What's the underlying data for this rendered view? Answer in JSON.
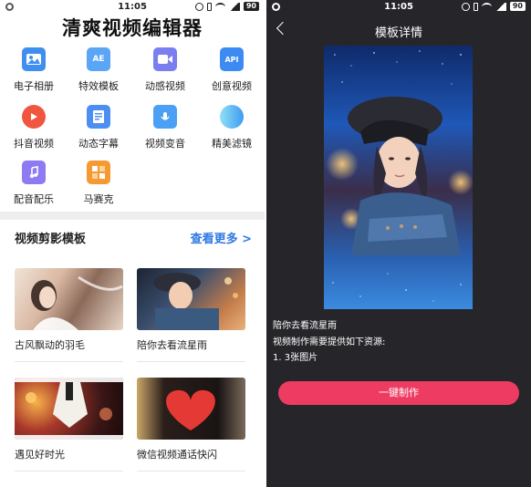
{
  "status": {
    "time": "11:05",
    "battery": "90"
  },
  "left": {
    "app_title": "清爽视频编辑器",
    "features": [
      {
        "label": "电子相册",
        "icon": "photo-album-icon",
        "color": "#3f8ef0"
      },
      {
        "label": "特效模板",
        "icon": "ae-template-icon",
        "color": "#5aa5f5",
        "glyph": "AE"
      },
      {
        "label": "动感视频",
        "icon": "dynamic-video-icon",
        "color": "#7a7ef0"
      },
      {
        "label": "创意视频",
        "icon": "api-icon",
        "color": "#3d8bf2",
        "glyph": "API"
      },
      {
        "label": "抖音视频",
        "icon": "douyin-play-icon",
        "color": "#f0553f"
      },
      {
        "label": "动态字幕",
        "icon": "subtitle-doc-icon",
        "color": "#4b8ff2"
      },
      {
        "label": "视频变音",
        "icon": "voice-change-icon",
        "color": "#4ba0f5"
      },
      {
        "label": "精美滤镜",
        "icon": "filter-icon",
        "color": "#49b8f0"
      },
      {
        "label": "配音配乐",
        "icon": "music-note-icon",
        "color": "#8e7af2"
      },
      {
        "label": "马赛克",
        "icon": "mosaic-icon",
        "color": "#f59a33"
      }
    ],
    "section_title": "视频剪影模板",
    "see_more": "查看更多 >",
    "templates": [
      {
        "caption": "古风飘动的羽毛"
      },
      {
        "caption": "陪你去看流星雨"
      },
      {
        "caption": "遇见好时光"
      },
      {
        "caption": "微信视频通话快闪"
      }
    ]
  },
  "right": {
    "title": "模板详情",
    "template_name": "陪你去看流星雨",
    "requirement_heading": "视频制作需要提供如下资源:",
    "requirement_item": "1. 3张图片",
    "make_button": "一键制作"
  }
}
